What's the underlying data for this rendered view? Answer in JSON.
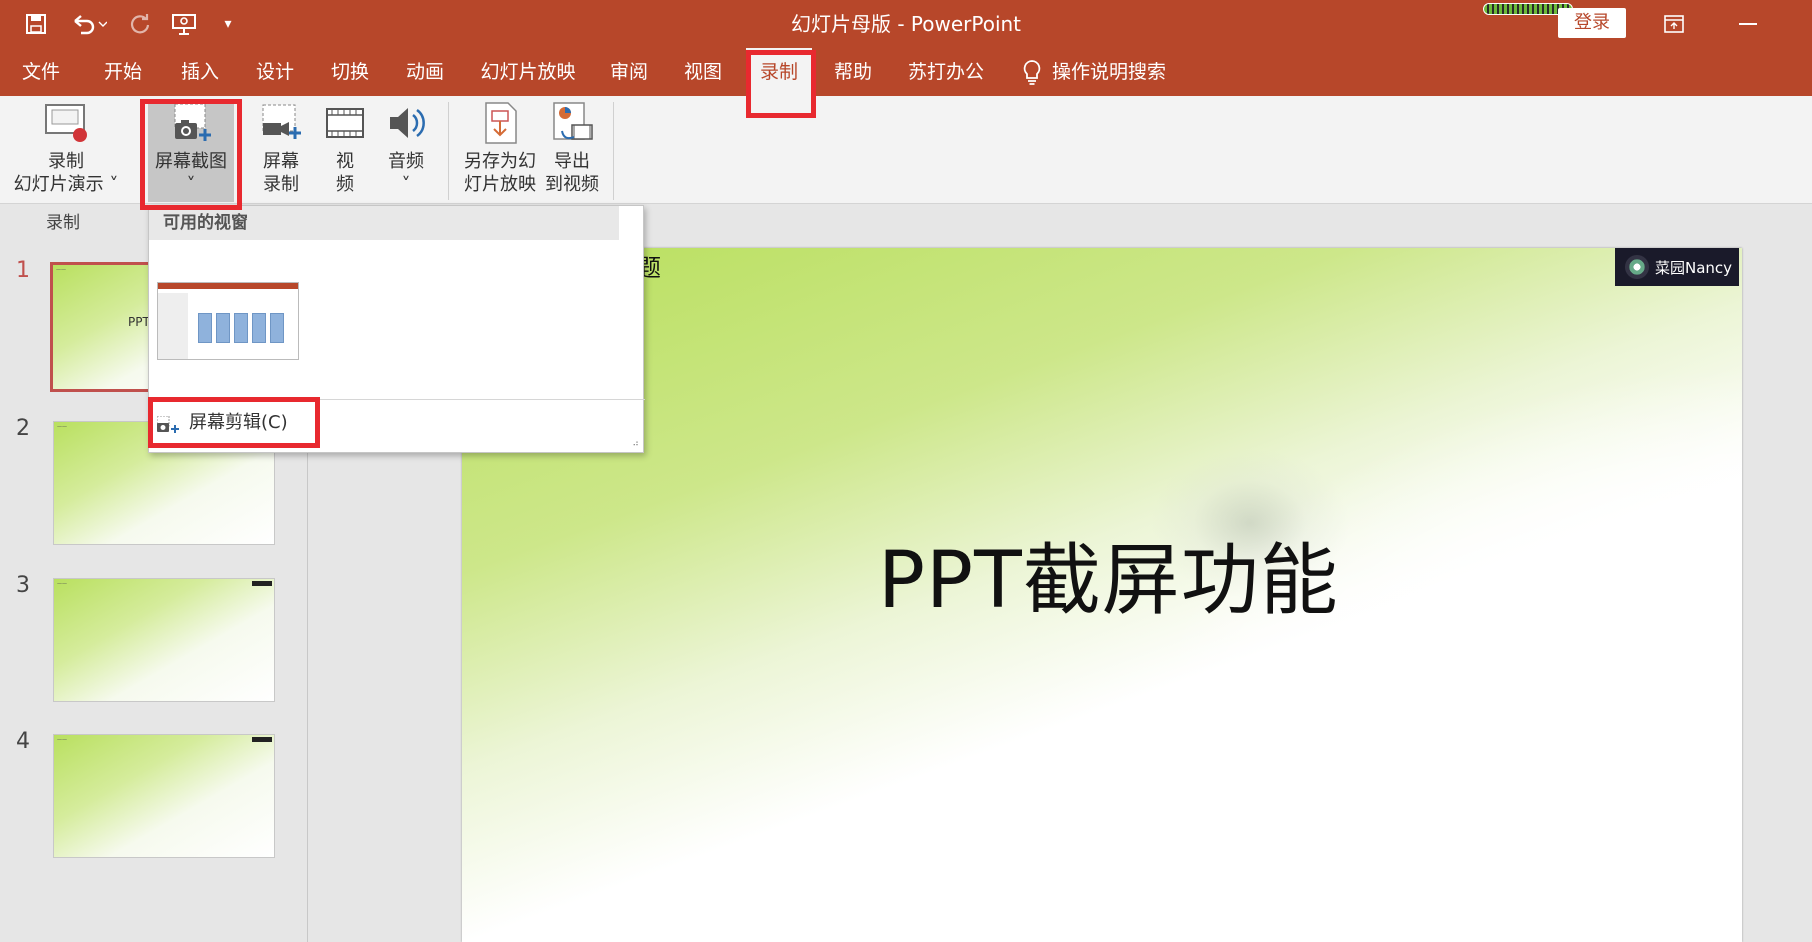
{
  "window": {
    "title": "幻灯片母版  -  PowerPoint",
    "login_label": "登录"
  },
  "qat": {
    "icons": [
      "save-icon",
      "undo-icon",
      "redo-icon",
      "present-icon",
      "customize-icon"
    ]
  },
  "tabs": [
    {
      "label": "文件"
    },
    {
      "label": "开始"
    },
    {
      "label": "插入"
    },
    {
      "label": "设计"
    },
    {
      "label": "切换"
    },
    {
      "label": "动画"
    },
    {
      "label": "幻灯片放映"
    },
    {
      "label": "审阅"
    },
    {
      "label": "视图"
    },
    {
      "label": "录制",
      "active": true
    },
    {
      "label": "帮助"
    },
    {
      "label": "苏打办公"
    },
    {
      "label": "操作说明搜索"
    }
  ],
  "ribbon": {
    "record_slideshow": {
      "line1": "录制",
      "line2": "幻灯片演示 ˅"
    },
    "screenshot": {
      "line1": "屏幕截图",
      "line2": "˅"
    },
    "screen_record": {
      "line1": "屏幕",
      "line2": "录制"
    },
    "video": {
      "line1": "视",
      "line2": "频"
    },
    "audio": {
      "line1": "音频",
      "line2": "˅"
    },
    "save_as_show": {
      "line1": "另存为幻",
      "line2": "灯片放映"
    },
    "export_video": {
      "line1": "导出",
      "line2": "到视频"
    },
    "group_label": "录制"
  },
  "dropdown": {
    "header": "可用的视窗",
    "screen_clip": "屏幕剪辑(C)"
  },
  "slides": [
    {
      "number": "1",
      "label": "PPT"
    },
    {
      "number": "2"
    },
    {
      "number": "3"
    },
    {
      "number": "4"
    }
  ],
  "editor": {
    "top_text": "题",
    "title": "PPT截屏功能",
    "watermark": "菜园Nancy"
  },
  "colors": {
    "accent": "#b7472a",
    "highlight": "#e8292f"
  }
}
